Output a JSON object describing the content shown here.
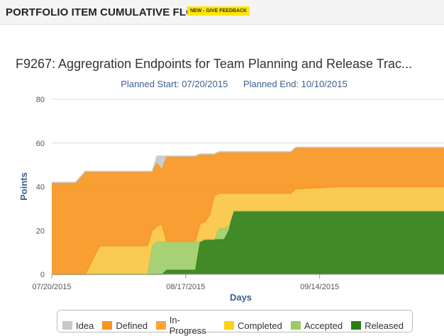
{
  "header": {
    "title": "PORTFOLIO ITEM CUMULATIVE FLOW",
    "feedback_label": "NEW - GIVE FEEDBACK"
  },
  "chart_data": {
    "type": "area",
    "title": "F9267: Aggregration Endpoints for Team Planning and Release Trac...",
    "subtitle": {
      "planned_start": "Planned Start: 07/20/2015",
      "planned_end": "Planned End: 10/10/2015"
    },
    "xlabel": "Days",
    "ylabel": "Points",
    "ylim": [
      0,
      80
    ],
    "yticks": [
      0,
      20,
      40,
      60,
      80
    ],
    "xlim": [
      0,
      82
    ],
    "xticks": [
      {
        "day": 0,
        "label": "07/20/2015"
      },
      {
        "day": 28,
        "label": "08/17/2015"
      },
      {
        "day": 56,
        "label": "09/14/2015"
      }
    ],
    "stacked": true,
    "grid": true,
    "legend_position": "bottom",
    "x": [
      0,
      5,
      7,
      10,
      20,
      21,
      22,
      23,
      24,
      25,
      26,
      27,
      30,
      31,
      32,
      33,
      34,
      35,
      36,
      37,
      38,
      40,
      41,
      50,
      51,
      60,
      82
    ],
    "series": [
      {
        "name": "Released",
        "color": "#2e7d10",
        "values": [
          0,
          0,
          0,
          0,
          0,
          0,
          0,
          0,
          2,
          2,
          2,
          2,
          2,
          15,
          16,
          16,
          16,
          16,
          16,
          20,
          29,
          29,
          29,
          29,
          29,
          29,
          29
        ]
      },
      {
        "name": "Accepted",
        "color": "#9ccc65",
        "values": [
          0,
          0,
          0,
          0,
          0,
          13,
          15,
          15,
          13,
          13,
          13,
          13,
          13,
          0,
          0,
          0,
          0,
          5,
          5,
          2,
          0,
          0,
          0,
          0,
          0,
          0,
          0
        ]
      },
      {
        "name": "Completed",
        "color": "#f9c440",
        "values": [
          0,
          0,
          0,
          13,
          13,
          7,
          7,
          8,
          0,
          0,
          0,
          0,
          0,
          8,
          8,
          11,
          20,
          16,
          16,
          15,
          8,
          8,
          8,
          8,
          10,
          11,
          11
        ]
      },
      {
        "name": "In-Progress",
        "color": "#f7a535",
        "values": [
          0,
          0,
          0,
          0,
          0,
          0,
          0,
          0,
          0,
          0,
          0,
          0,
          0,
          0,
          0,
          0,
          0,
          0,
          0,
          0,
          0,
          0,
          0,
          0,
          0,
          0,
          0
        ]
      },
      {
        "name": "Defined",
        "color": "#f7941d",
        "values": [
          42,
          42,
          47,
          34,
          34,
          27,
          29,
          25,
          39,
          39,
          39,
          39,
          39,
          32,
          31,
          28,
          19,
          19,
          19,
          19,
          19,
          19,
          19,
          19,
          19,
          18,
          18
        ]
      },
      {
        "name": "Idea",
        "color": "#c8c8c8",
        "values": [
          0,
          0,
          0,
          0,
          0,
          0,
          3,
          6,
          0,
          0,
          0,
          0,
          0,
          0,
          0,
          0,
          0,
          0,
          0,
          0,
          0,
          0,
          0,
          0,
          0,
          0,
          0
        ]
      }
    ]
  },
  "legend": {
    "items": [
      {
        "label": "Idea",
        "color": "#c8c8c8"
      },
      {
        "label": "Defined",
        "color": "#f7941d"
      },
      {
        "label": "In-Progress",
        "color": "#f7a535"
      },
      {
        "label": "Completed",
        "color": "#fcd116"
      },
      {
        "label": "Accepted",
        "color": "#9ccc65"
      },
      {
        "label": "Released",
        "color": "#2e7d10"
      }
    ]
  }
}
